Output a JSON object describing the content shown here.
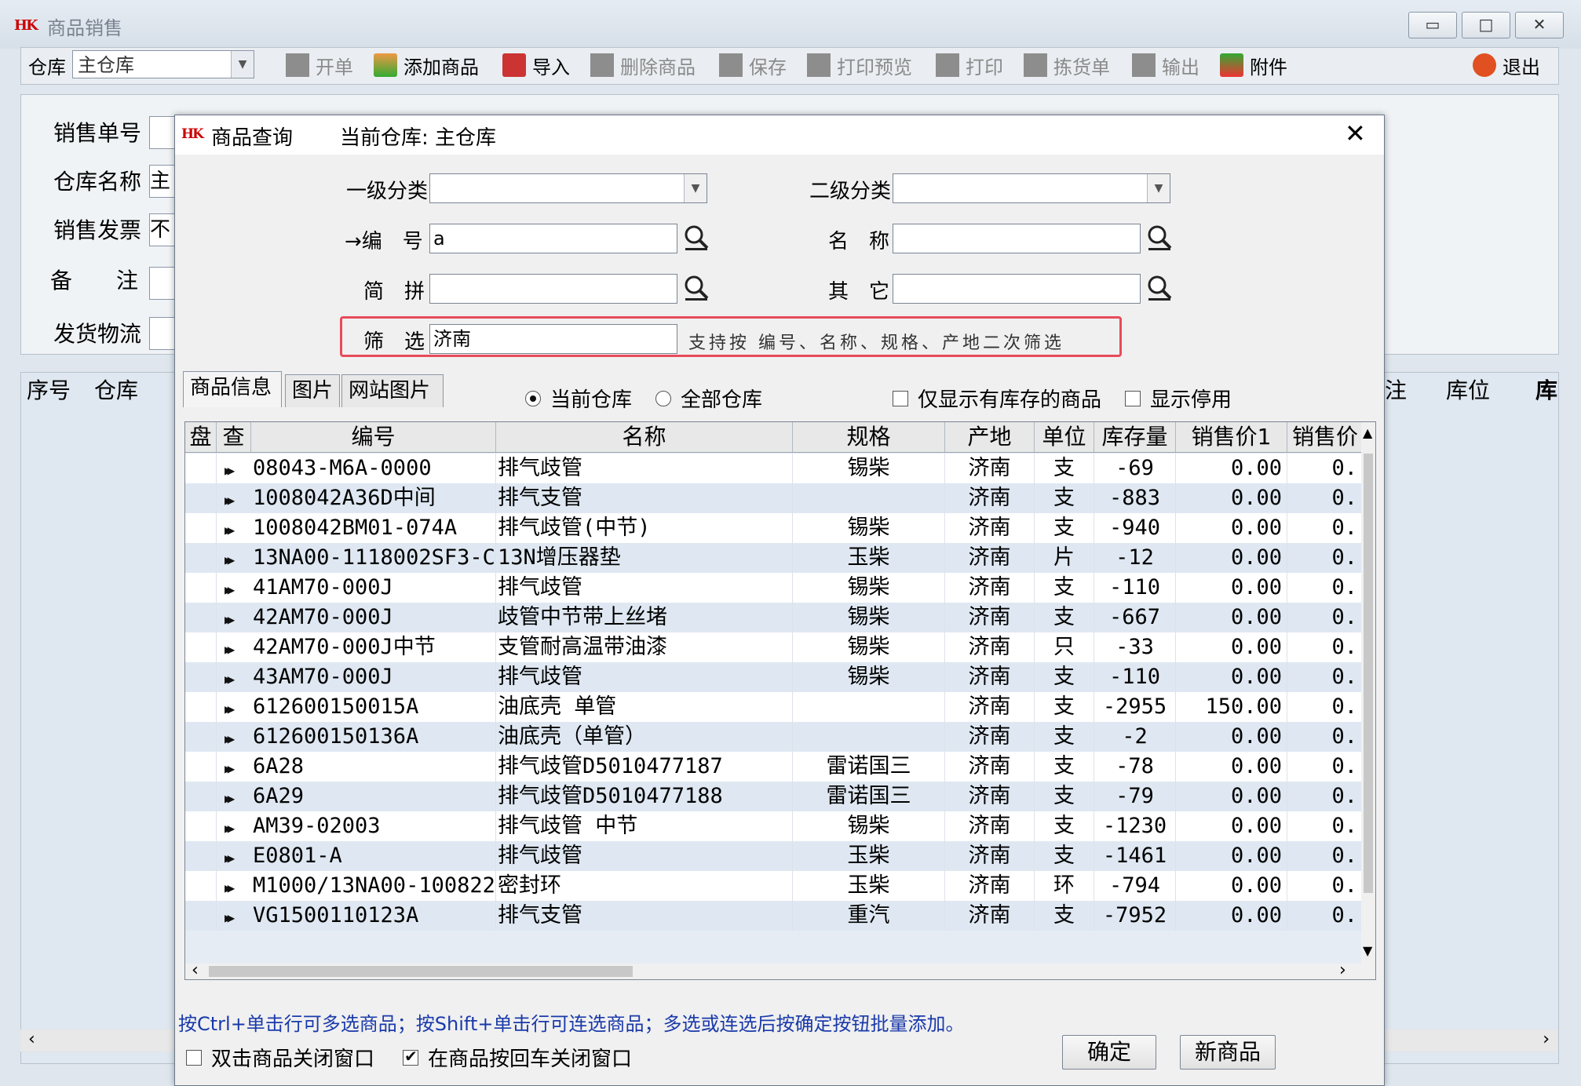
{
  "app": {
    "title": "商品销售",
    "logo": "HK",
    "window_controls": [
      "▭",
      "□",
      "✕"
    ]
  },
  "toolbar": {
    "warehouse_label": "仓库",
    "warehouse_value": "主仓库",
    "items": [
      {
        "label": "开单",
        "enabled": false
      },
      {
        "label": "添加商品",
        "enabled": true
      },
      {
        "label": "导入",
        "enabled": true
      },
      {
        "label": "删除商品",
        "enabled": false
      },
      {
        "label": "保存",
        "enabled": false
      },
      {
        "label": "打印预览",
        "enabled": false
      },
      {
        "label": "打印",
        "enabled": false
      },
      {
        "label": "拣货单",
        "enabled": false
      },
      {
        "label": "输出",
        "enabled": false
      },
      {
        "label": "附件",
        "enabled": true
      }
    ],
    "exit_label": "退出"
  },
  "form": {
    "order_no_label": "销售单号",
    "warehouse_name_label": "仓库名称",
    "warehouse_name_value": "主",
    "invoice_label": "销售发票",
    "invoice_value": "不",
    "remark_label": "备　　注",
    "logistics_label": "发货物流"
  },
  "back_grid": {
    "headers_left": [
      "序号",
      "仓库"
    ],
    "headers_right": [
      "注",
      "库位",
      "库"
    ]
  },
  "dialog": {
    "title": "商品查询",
    "logo": "HK",
    "current_warehouse": "当前仓库: 主仓库",
    "close": "✕",
    "cat1_label": "一级分类",
    "cat1_value": "",
    "cat2_label": "二级分类",
    "cat2_value": "",
    "code_label": "→编　号",
    "code_value": "a",
    "name_label": "名　称",
    "name_value": "",
    "pinyin_label": "简　拼",
    "pinyin_value": "",
    "other_label": "其　它",
    "other_value": "",
    "filter_label": "筛　选",
    "filter_value": "济南",
    "filter_hint": "支持按 编号、名称、规格、产地二次筛选",
    "tabs": [
      "商品信息",
      "图片",
      "网站图片"
    ],
    "radio_current": "当前仓库",
    "radio_all": "全部仓库",
    "chk_in_stock": "仅显示有库存的商品",
    "chk_disabled": "显示停用",
    "grid": {
      "headers": [
        "盘",
        "查",
        "编号",
        "名称",
        "规格",
        "产地",
        "单位",
        "库存量",
        "销售价1",
        "销售价"
      ],
      "rows": [
        {
          "code": "08043-M6A-0000",
          "name": "排气歧管",
          "spec": "锡柴",
          "origin": "济南",
          "unit": "支",
          "stock": "-69",
          "price1": "0.00",
          "price2": "0."
        },
        {
          "code": "1008042A36D中间",
          "name": "排气支管",
          "spec": "",
          "origin": "济南",
          "unit": "支",
          "stock": "-883",
          "price1": "0.00",
          "price2": "0."
        },
        {
          "code": "1008042BM01-074A",
          "name": "排气歧管(中节)",
          "spec": "锡柴",
          "origin": "济南",
          "unit": "支",
          "stock": "-940",
          "price1": "0.00",
          "price2": "0."
        },
        {
          "code": "13NA00-1118002SF3-C",
          "name": "13N增压器垫",
          "spec": "玉柴",
          "origin": "济南",
          "unit": "片",
          "stock": "-12",
          "price1": "0.00",
          "price2": "0."
        },
        {
          "code": "41AM70-000J",
          "name": "排气歧管",
          "spec": "锡柴",
          "origin": "济南",
          "unit": "支",
          "stock": "-110",
          "price1": "0.00",
          "price2": "0."
        },
        {
          "code": "42AM70-000J",
          "name": "歧管中节带上丝堵",
          "spec": "锡柴",
          "origin": "济南",
          "unit": "支",
          "stock": "-667",
          "price1": "0.00",
          "price2": "0."
        },
        {
          "code": "42AM70-000J中节",
          "name": "支管耐高温带油漆",
          "spec": "锡柴",
          "origin": "济南",
          "unit": "只",
          "stock": "-33",
          "price1": "0.00",
          "price2": "0."
        },
        {
          "code": "43AM70-000J",
          "name": "排气歧管",
          "spec": "锡柴",
          "origin": "济南",
          "unit": "支",
          "stock": "-110",
          "price1": "0.00",
          "price2": "0."
        },
        {
          "code": "612600150015A",
          "name": "油底壳 单管",
          "spec": "",
          "origin": "济南",
          "unit": "支",
          "stock": "-2955",
          "price1": "150.00",
          "price2": "0."
        },
        {
          "code": "612600150136A",
          "name": "油底壳（单管）",
          "spec": "",
          "origin": "济南",
          "unit": "支",
          "stock": "-2",
          "price1": "0.00",
          "price2": "0."
        },
        {
          "code": "6A28",
          "name": "排气歧管D5010477187",
          "spec": "雷诺国三",
          "origin": "济南",
          "unit": "支",
          "stock": "-78",
          "price1": "0.00",
          "price2": "0."
        },
        {
          "code": "6A29",
          "name": "排气歧管D5010477188",
          "spec": "雷诺国三",
          "origin": "济南",
          "unit": "支",
          "stock": "-79",
          "price1": "0.00",
          "price2": "0."
        },
        {
          "code": "AM39-02003",
          "name": "排气歧管 中节",
          "spec": "锡柴",
          "origin": "济南",
          "unit": "支",
          "stock": "-1230",
          "price1": "0.00",
          "price2": "0."
        },
        {
          "code": "E0801-A",
          "name": "排气歧管",
          "spec": "玉柴",
          "origin": "济南",
          "unit": "支",
          "stock": "-1461",
          "price1": "0.00",
          "price2": "0."
        },
        {
          "code": "M1000/13NA00-100822",
          "name": "密封环",
          "spec": "玉柴",
          "origin": "济南",
          "unit": "环",
          "stock": "-794",
          "price1": "0.00",
          "price2": "0."
        },
        {
          "code": "VG1500110123A",
          "name": "排气支管",
          "spec": "重汽",
          "origin": "济南",
          "unit": "支",
          "stock": "-7952",
          "price1": "0.00",
          "price2": "0."
        }
      ]
    },
    "status_hint": "按Ctrl+单击行可多选商品；按Shift+单击行可连选商品；多选或连选后按确定按钮批量添加。",
    "chk_dblclick_close": "双击商品关闭窗口",
    "chk_enter_close": "在商品按回车关闭窗口",
    "ok_button": "确定",
    "new_button": "新商品"
  }
}
